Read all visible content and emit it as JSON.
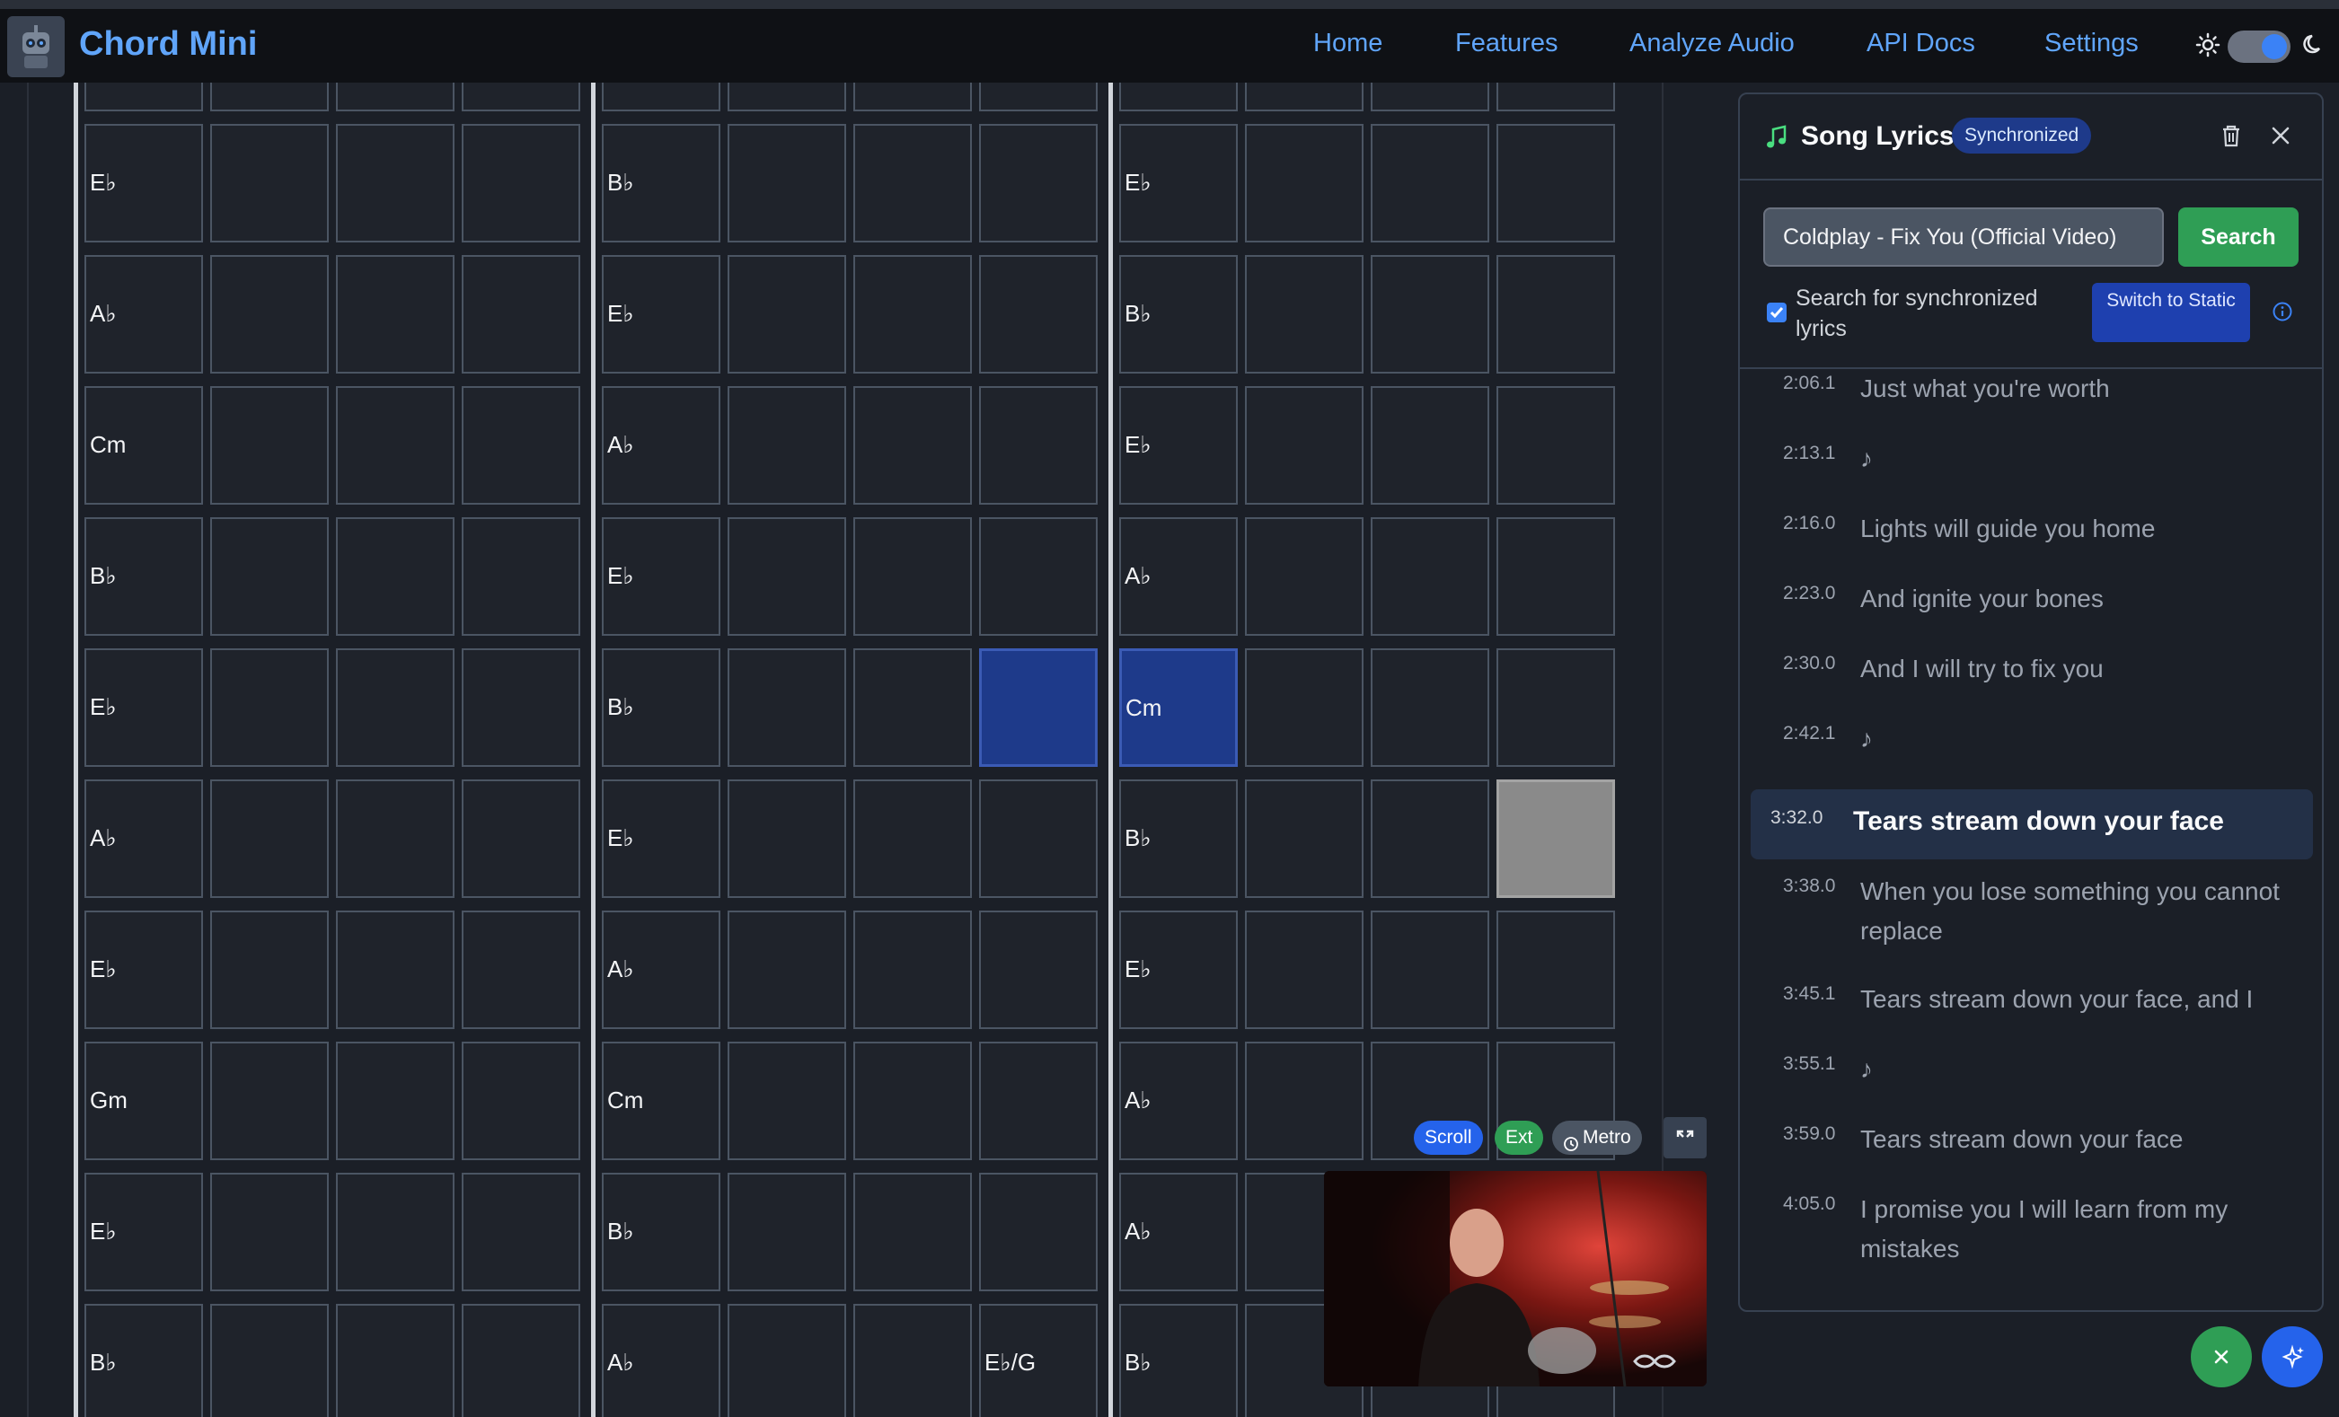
{
  "app": {
    "title": "Chord Mini"
  },
  "nav": {
    "links": [
      {
        "label": "Home"
      },
      {
        "label": "Features"
      },
      {
        "label": "Analyze Audio"
      },
      {
        "label": "API Docs"
      },
      {
        "label": "Settings"
      }
    ]
  },
  "theme_toggle": {
    "mode": "dark"
  },
  "chord_grid": {
    "sections": [
      {
        "rows": [
          [
            "Eb",
            "",
            "",
            ""
          ],
          [
            "Ab",
            "",
            "",
            ""
          ],
          [
            "Cm",
            "",
            "",
            ""
          ],
          [
            "Bb",
            "",
            "",
            ""
          ],
          [
            "Eb",
            "",
            "",
            ""
          ],
          [
            "Ab",
            "",
            "",
            ""
          ],
          [
            "Eb",
            "",
            "",
            ""
          ],
          [
            "Gm",
            "",
            "",
            ""
          ],
          [
            "Eb",
            "",
            "",
            ""
          ],
          [
            "Bb",
            "",
            "",
            ""
          ]
        ]
      },
      {
        "rows": [
          [
            "Bb",
            "",
            "",
            ""
          ],
          [
            "Eb",
            "",
            "",
            ""
          ],
          [
            "Ab",
            "",
            "",
            ""
          ],
          [
            "Eb",
            "",
            "",
            ""
          ],
          [
            "Bb",
            "",
            "",
            ""
          ],
          [
            "Eb",
            "",
            "",
            ""
          ],
          [
            "Ab",
            "",
            "",
            ""
          ],
          [
            "Cm",
            "",
            "",
            ""
          ],
          [
            "Bb",
            "",
            "",
            ""
          ],
          [
            "Ab",
            "",
            "",
            "Eb/G"
          ]
        ]
      },
      {
        "rows": [
          [
            "Eb",
            "",
            "",
            ""
          ],
          [
            "Bb",
            "",
            "",
            ""
          ],
          [
            "Eb",
            "",
            "",
            ""
          ],
          [
            "Ab",
            "",
            "",
            ""
          ],
          [
            "Cm",
            "",
            "",
            ""
          ],
          [
            "Bb",
            "",
            "",
            ""
          ],
          [
            "Eb",
            "",
            "",
            ""
          ],
          [
            "Ab",
            "",
            "",
            ""
          ],
          [
            "Ab",
            "",
            "",
            ""
          ],
          [
            "Bb",
            "",
            "",
            ""
          ]
        ]
      }
    ],
    "display_labels": {
      "Eb": "E♭",
      "Ab": "A♭",
      "Bb": "B♭",
      "Cm": "Cm",
      "Gm": "Gm",
      "Eb/G": "E♭/G"
    },
    "highlight_beat": {
      "section": 1,
      "row": 4,
      "col": 3
    },
    "current_beat": {
      "section": 2,
      "row": 4,
      "col": 0
    },
    "pending_beat": {
      "section": 2,
      "row": 5,
      "col": 3
    },
    "colors": {
      "current": "#1e3a8a",
      "pending": "#8a8a8a"
    }
  },
  "lyrics_panel": {
    "title": "Song Lyrics",
    "badge": "Synchronized",
    "search_value": "Coldplay - Fix You (Official Video)",
    "search_button": "Search",
    "sync_checkbox_label": "Search for synchronized lyrics",
    "sync_checked": true,
    "switch_button": "Switch to Static",
    "lines": [
      {
        "time": "2:06.1",
        "text": "Just what you're worth"
      },
      {
        "time": "2:13.1",
        "text": "♪"
      },
      {
        "time": "2:16.0",
        "text": "Lights will guide you home"
      },
      {
        "time": "2:23.0",
        "text": "And ignite your bones"
      },
      {
        "time": "2:30.0",
        "text": "And I will try to fix you"
      },
      {
        "time": "2:42.1",
        "text": "♪"
      },
      {
        "time": "3:32.0",
        "text": "Tears stream down your face",
        "current": true
      },
      {
        "time": "3:38.0",
        "text": "When you lose something you cannot replace"
      },
      {
        "time": "3:45.1",
        "text": "Tears stream down your face, and I"
      },
      {
        "time": "3:55.1",
        "text": "♪"
      },
      {
        "time": "3:59.0",
        "text": "Tears stream down your face"
      },
      {
        "time": "4:05.0",
        "text": "I promise you I will learn from my mistakes"
      }
    ]
  },
  "video_controls": {
    "scroll": "Scroll",
    "ext": "Ext",
    "metro": "Metro",
    "colors": {
      "scroll": "#2563eb",
      "ext": "#2f9e55",
      "metro": "#4b5563"
    }
  },
  "accent": {
    "brand": "#60a5fa",
    "green": "#2f9e55",
    "blue": "#2563eb"
  }
}
